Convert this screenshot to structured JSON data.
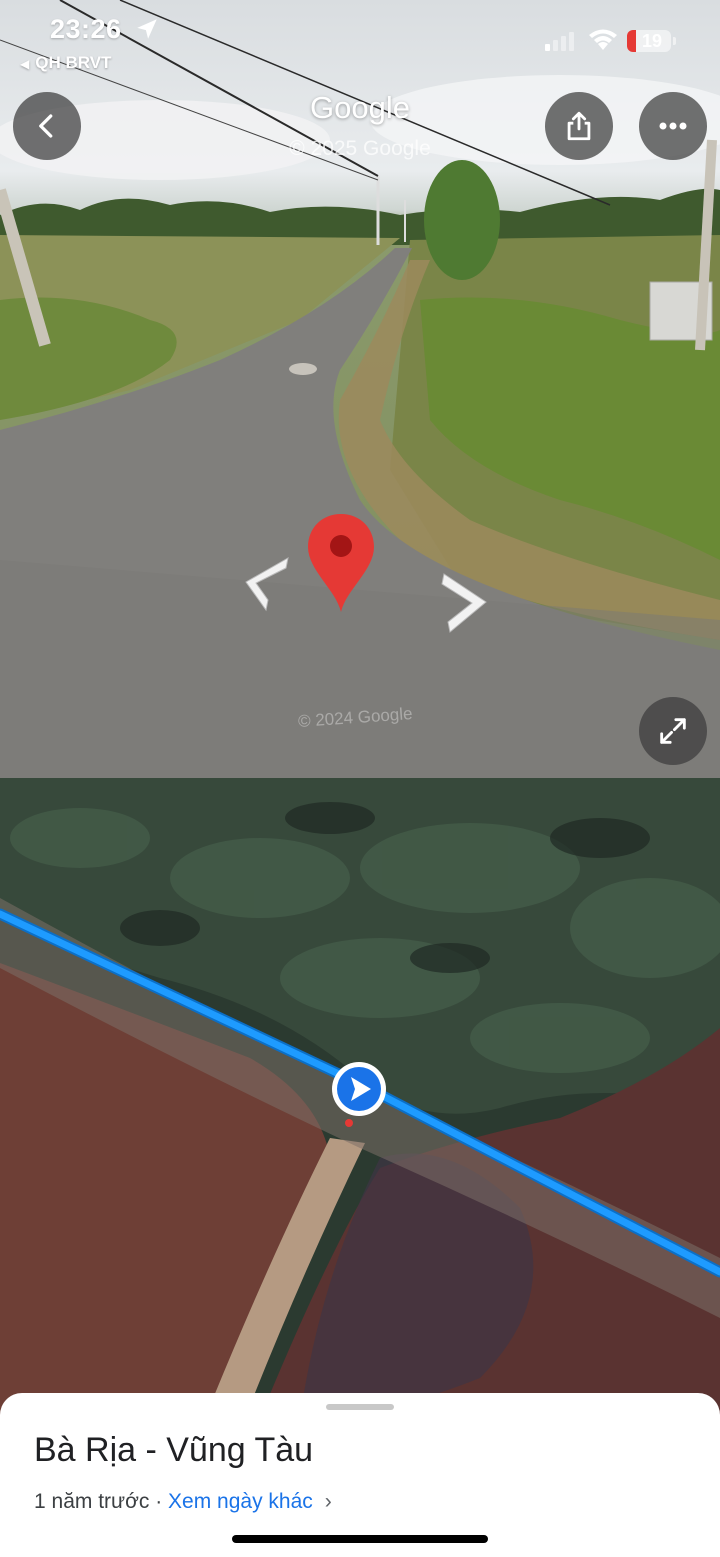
{
  "status_bar": {
    "time": "23:26",
    "back_app": "QH BRVT",
    "battery": "19"
  },
  "street_view": {
    "title": "Google",
    "copyright": "© 2025 Google",
    "watermark": "© 2024 Google",
    "icons": {
      "back": "chevron-left-icon",
      "share": "share-icon",
      "more": "more-horizontal-icon",
      "expand": "expand-icon",
      "pin": "location-pin-icon"
    }
  },
  "map": {
    "icons": {
      "position": "navigation-arrow-icon"
    },
    "route_color": "#1e9bff"
  },
  "sheet": {
    "place_name": "Bà Rịa - Vũng Tàu",
    "time_ago": "1 năm trước",
    "separator": " · ",
    "other_dates_link": "Xem ngày khác",
    "chevron": "›"
  },
  "colors": {
    "pin": "#e53935",
    "link": "#1a73e8"
  }
}
